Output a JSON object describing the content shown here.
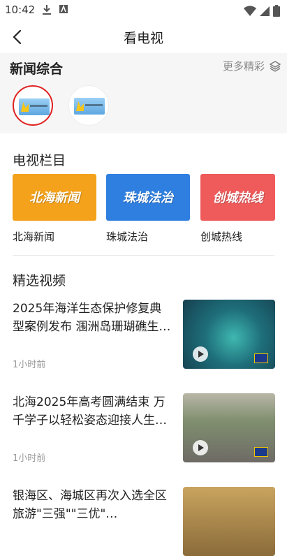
{
  "status": {
    "time": "10:42"
  },
  "nav": {
    "title": "看电视"
  },
  "news": {
    "title": "新闻综合",
    "more_label": "更多精彩"
  },
  "tv_section": {
    "title": "电视栏目",
    "programs": [
      {
        "thumb_text": "北海新闻",
        "label": "北海新闻",
        "color": "#f4a21b"
      },
      {
        "thumb_text": "珠城法治",
        "label": "珠城法治",
        "color": "#2f7fe0"
      },
      {
        "thumb_text": "创城热线",
        "label": "创城热线",
        "color": "#ef5a5a"
      }
    ]
  },
  "featured": {
    "title": "精选视频",
    "videos": [
      {
        "title": "2025年海洋生态保护修复典型案例发布 涠洲岛珊瑚礁生…",
        "time": "1小时前"
      },
      {
        "title": "北海2025年高考圆满结束 万千学子以轻松姿态迎接人生…",
        "time": "1小时前"
      },
      {
        "title": "银海区、海城区再次入选全区旅游\"三强\"\"三优\"…",
        "time": ""
      }
    ]
  }
}
